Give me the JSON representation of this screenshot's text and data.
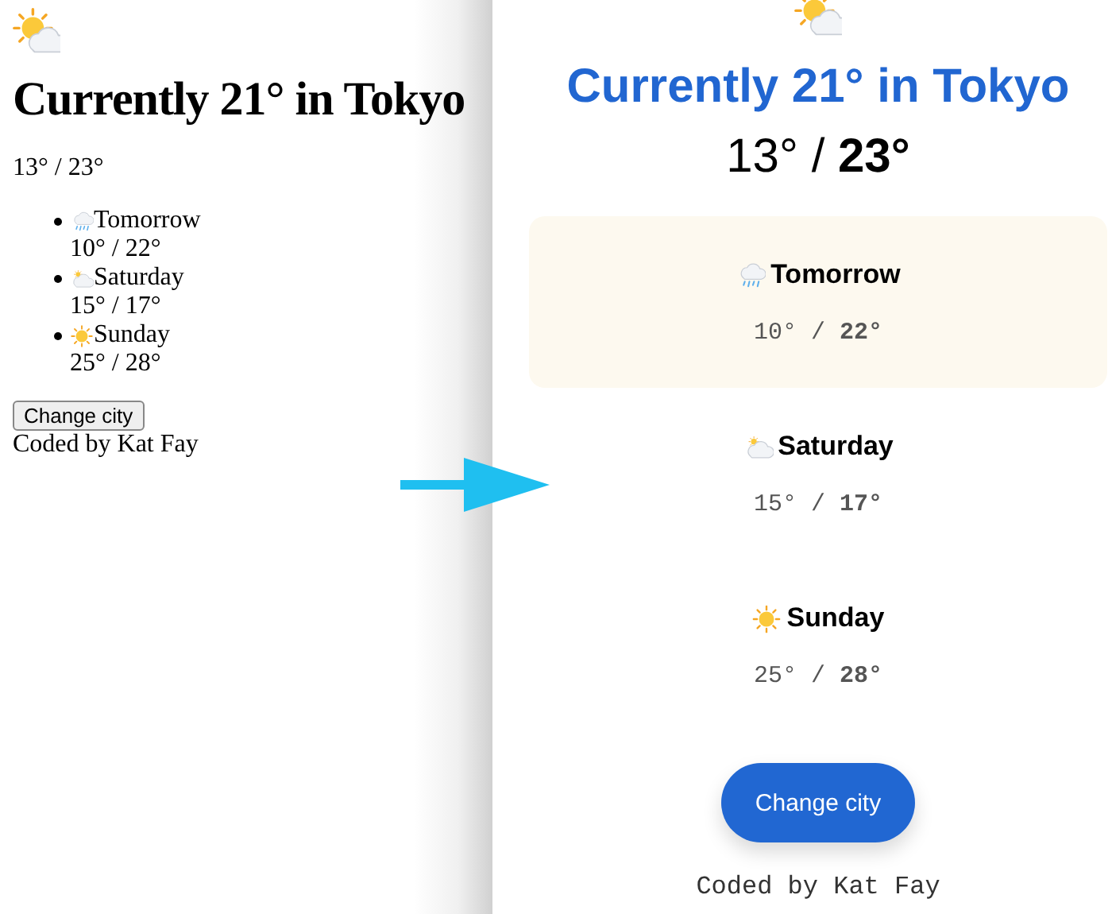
{
  "before": {
    "kind": "partly_cloudy",
    "title": "Currently 21° in Tokyo",
    "temperature": "13° / 23°",
    "forecast": [
      {
        "kind": "rain",
        "day": "Tomorrow",
        "temperature": "10° / 22°"
      },
      {
        "kind": "cloudy",
        "day": "Saturday",
        "temperature": "15° / 17°"
      },
      {
        "kind": "sunny",
        "day": "Sunday",
        "temperature": "25° / 28°"
      }
    ],
    "button": "Change city",
    "footer": "Coded by Kat Fay"
  },
  "after": {
    "kind": "partly_cloudy",
    "title": "Currently 21° in Tokyo",
    "temperature": "13° / **23°**",
    "forecast": [
      {
        "kind": "rain",
        "day": "Tomorrow",
        "temperature": "10° / **22°**",
        "selected": true
      },
      {
        "kind": "cloudy",
        "day": "Saturday",
        "temperature": "15° / **17°**",
        "selected": false
      },
      {
        "kind": "sunny",
        "day": "Sunday",
        "temperature": "25° / **28°**",
        "selected": false
      }
    ],
    "button": "Change city",
    "footer": "Coded by Kat Fay"
  }
}
